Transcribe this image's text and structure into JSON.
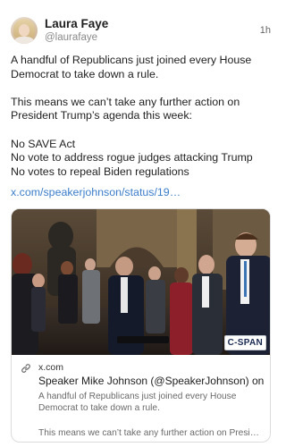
{
  "author": {
    "name": "Laura Faye",
    "handle": "@laurafaye",
    "timestamp": "1h"
  },
  "post": {
    "paragraphs": [
      "A handful of Republicans just joined every House Democrat to take down a rule.",
      "This means we can’t take any further action on President Trump’s agenda this week:",
      "No SAVE Act\nNo vote to address rogue judges attacking Trump\nNo votes to repeal Biden regulations"
    ],
    "link_text": "x.com/speakerjohnson/status/19…"
  },
  "link_card": {
    "image_icon": "video-still",
    "watermark": "C-SPAN",
    "link_icon": "link-icon",
    "domain": "x.com",
    "title": "Speaker Mike Johnson (@SpeakerJohnson) on X",
    "description": "A handful of Republicans just joined every House Democrat to take down a rule.",
    "description_2": "This means we can’t take any further action on Presid…"
  }
}
